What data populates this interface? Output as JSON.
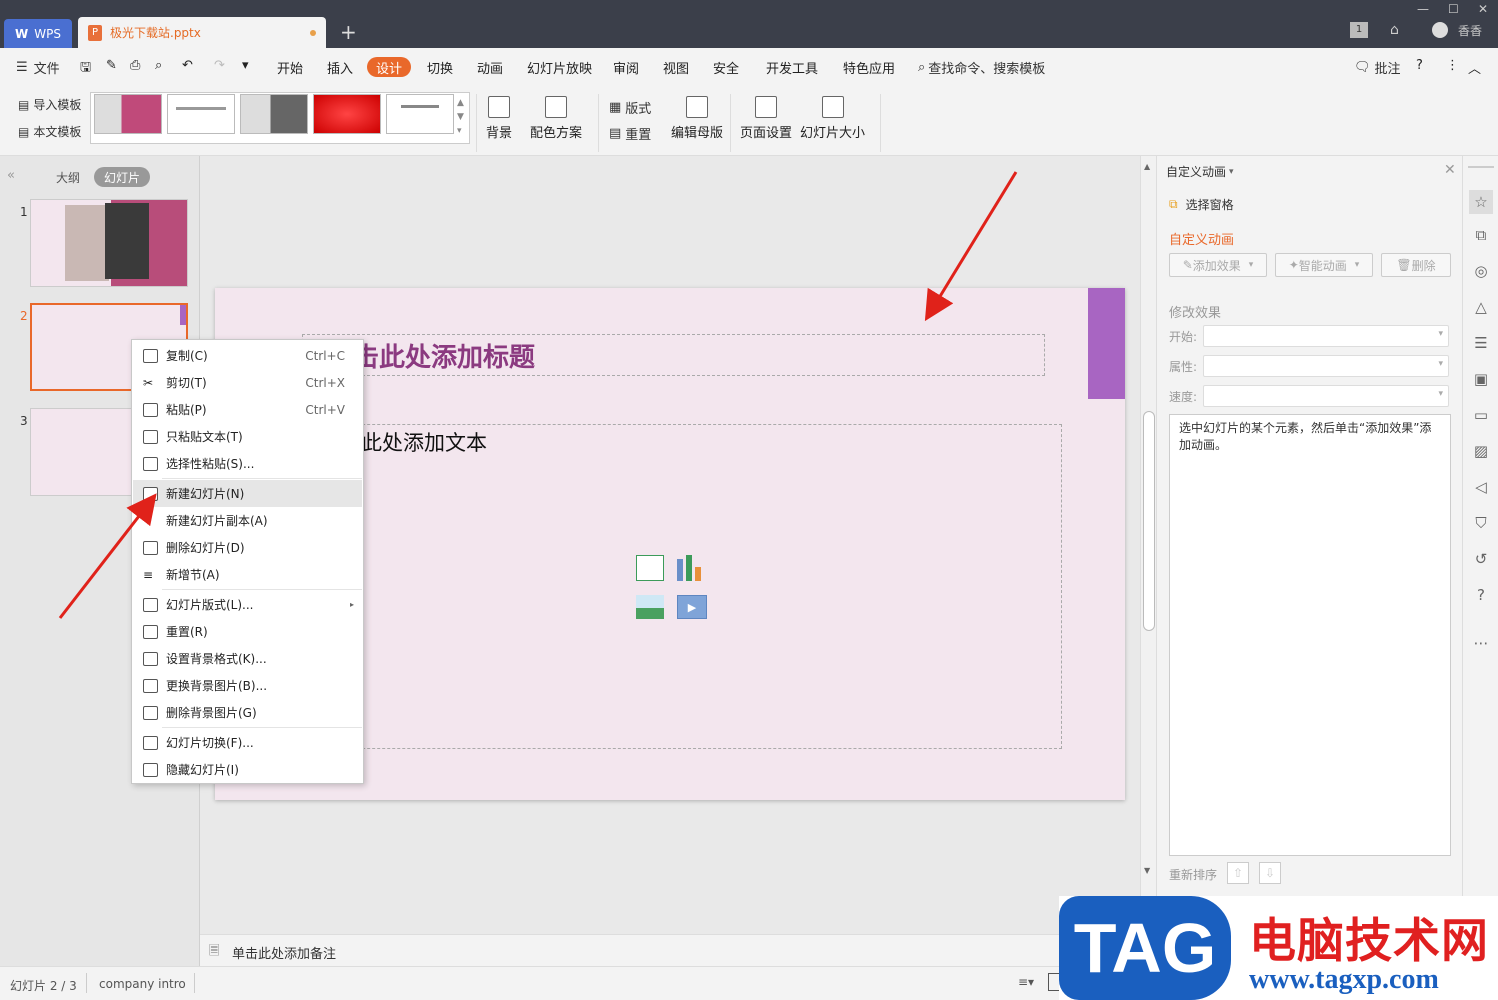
{
  "titlebar": {
    "wps_tab": "WPS",
    "doc_tab": "极光下载站.pptx",
    "user": "香香",
    "badge": "1"
  },
  "menu": {
    "file": "文件",
    "items": [
      "开始",
      "插入",
      "设计",
      "切换",
      "动画",
      "幻灯片放映",
      "审阅",
      "视图",
      "安全",
      "开发工具",
      "特色应用"
    ],
    "active": "设计",
    "search": "查找命令、搜索模板",
    "comment": "批注"
  },
  "ribbon": {
    "import_template": "导入模板",
    "this_template": "本文模板",
    "background": "背景",
    "color_scheme": "配色方案",
    "layout": "版式",
    "reset": "重置",
    "edit_master": "编辑母版",
    "page_setup": "页面设置",
    "slide_size": "幻灯片大小"
  },
  "left_panel": {
    "outline_tab": "大纲",
    "slides_tab": "幻灯片",
    "slide_numbers": [
      "1",
      "2",
      "3"
    ]
  },
  "slide": {
    "title_placeholder": "单击此处添加标题",
    "title_visible": "击此处添加标题",
    "body_visible": "此处添加文本"
  },
  "context_menu": {
    "items": [
      {
        "label": "复制(C)",
        "shortcut": "Ctrl+C"
      },
      {
        "label": "剪切(T)",
        "shortcut": "Ctrl+X"
      },
      {
        "label": "粘贴(P)",
        "shortcut": "Ctrl+V"
      },
      {
        "label": "只粘贴文本(T)",
        "shortcut": ""
      },
      {
        "label": "选择性粘贴(S)...",
        "shortcut": ""
      },
      {
        "label": "新建幻灯片(N)",
        "shortcut": ""
      },
      {
        "label": "新建幻灯片副本(A)",
        "shortcut": ""
      },
      {
        "label": "删除幻灯片(D)",
        "shortcut": ""
      },
      {
        "label": "新增节(A)",
        "shortcut": ""
      },
      {
        "label": "幻灯片版式(L)...",
        "shortcut": ""
      },
      {
        "label": "重置(R)",
        "shortcut": ""
      },
      {
        "label": "设置背景格式(K)...",
        "shortcut": ""
      },
      {
        "label": "更换背景图片(B)...",
        "shortcut": ""
      },
      {
        "label": "删除背景图片(G)",
        "shortcut": ""
      },
      {
        "label": "幻灯片切换(F)...",
        "shortcut": ""
      },
      {
        "label": "隐藏幻灯片(I)",
        "shortcut": ""
      }
    ],
    "highlighted": "新建幻灯片(N)"
  },
  "right_panel": {
    "header": "自定义动画",
    "selection_pane": "选择窗格",
    "section_title": "自定义动画",
    "add_effect": "添加效果",
    "smart_anim": "智能动画",
    "delete": "删除",
    "modify_effect": "修改效果",
    "start_label": "开始:",
    "property_label": "属性:",
    "speed_label": "速度:",
    "hint": "选中幻灯片的某个元素，然后单击“添加效果”添加动画。",
    "reorder": "重新排序"
  },
  "notes": {
    "placeholder": "单击此处添加备注"
  },
  "status": {
    "slide_info": "幻灯片 2 / 3",
    "theme": "company intro"
  },
  "watermark": {
    "tag": "TAG",
    "site_name": "电脑技术网",
    "url": "www.tagxp.com"
  },
  "colors": {
    "accent": "#e9682a",
    "titlebar": "#3b3f4a",
    "wps_blue": "#4a6fd1",
    "slide_bg": "#f3e6ee",
    "slide_title": "#8b3a80",
    "slide_accent_bar": "#a865c2",
    "arrow_red": "#e0221a",
    "wm_blue": "#1a5fbf",
    "wm_red": "#e02020"
  }
}
